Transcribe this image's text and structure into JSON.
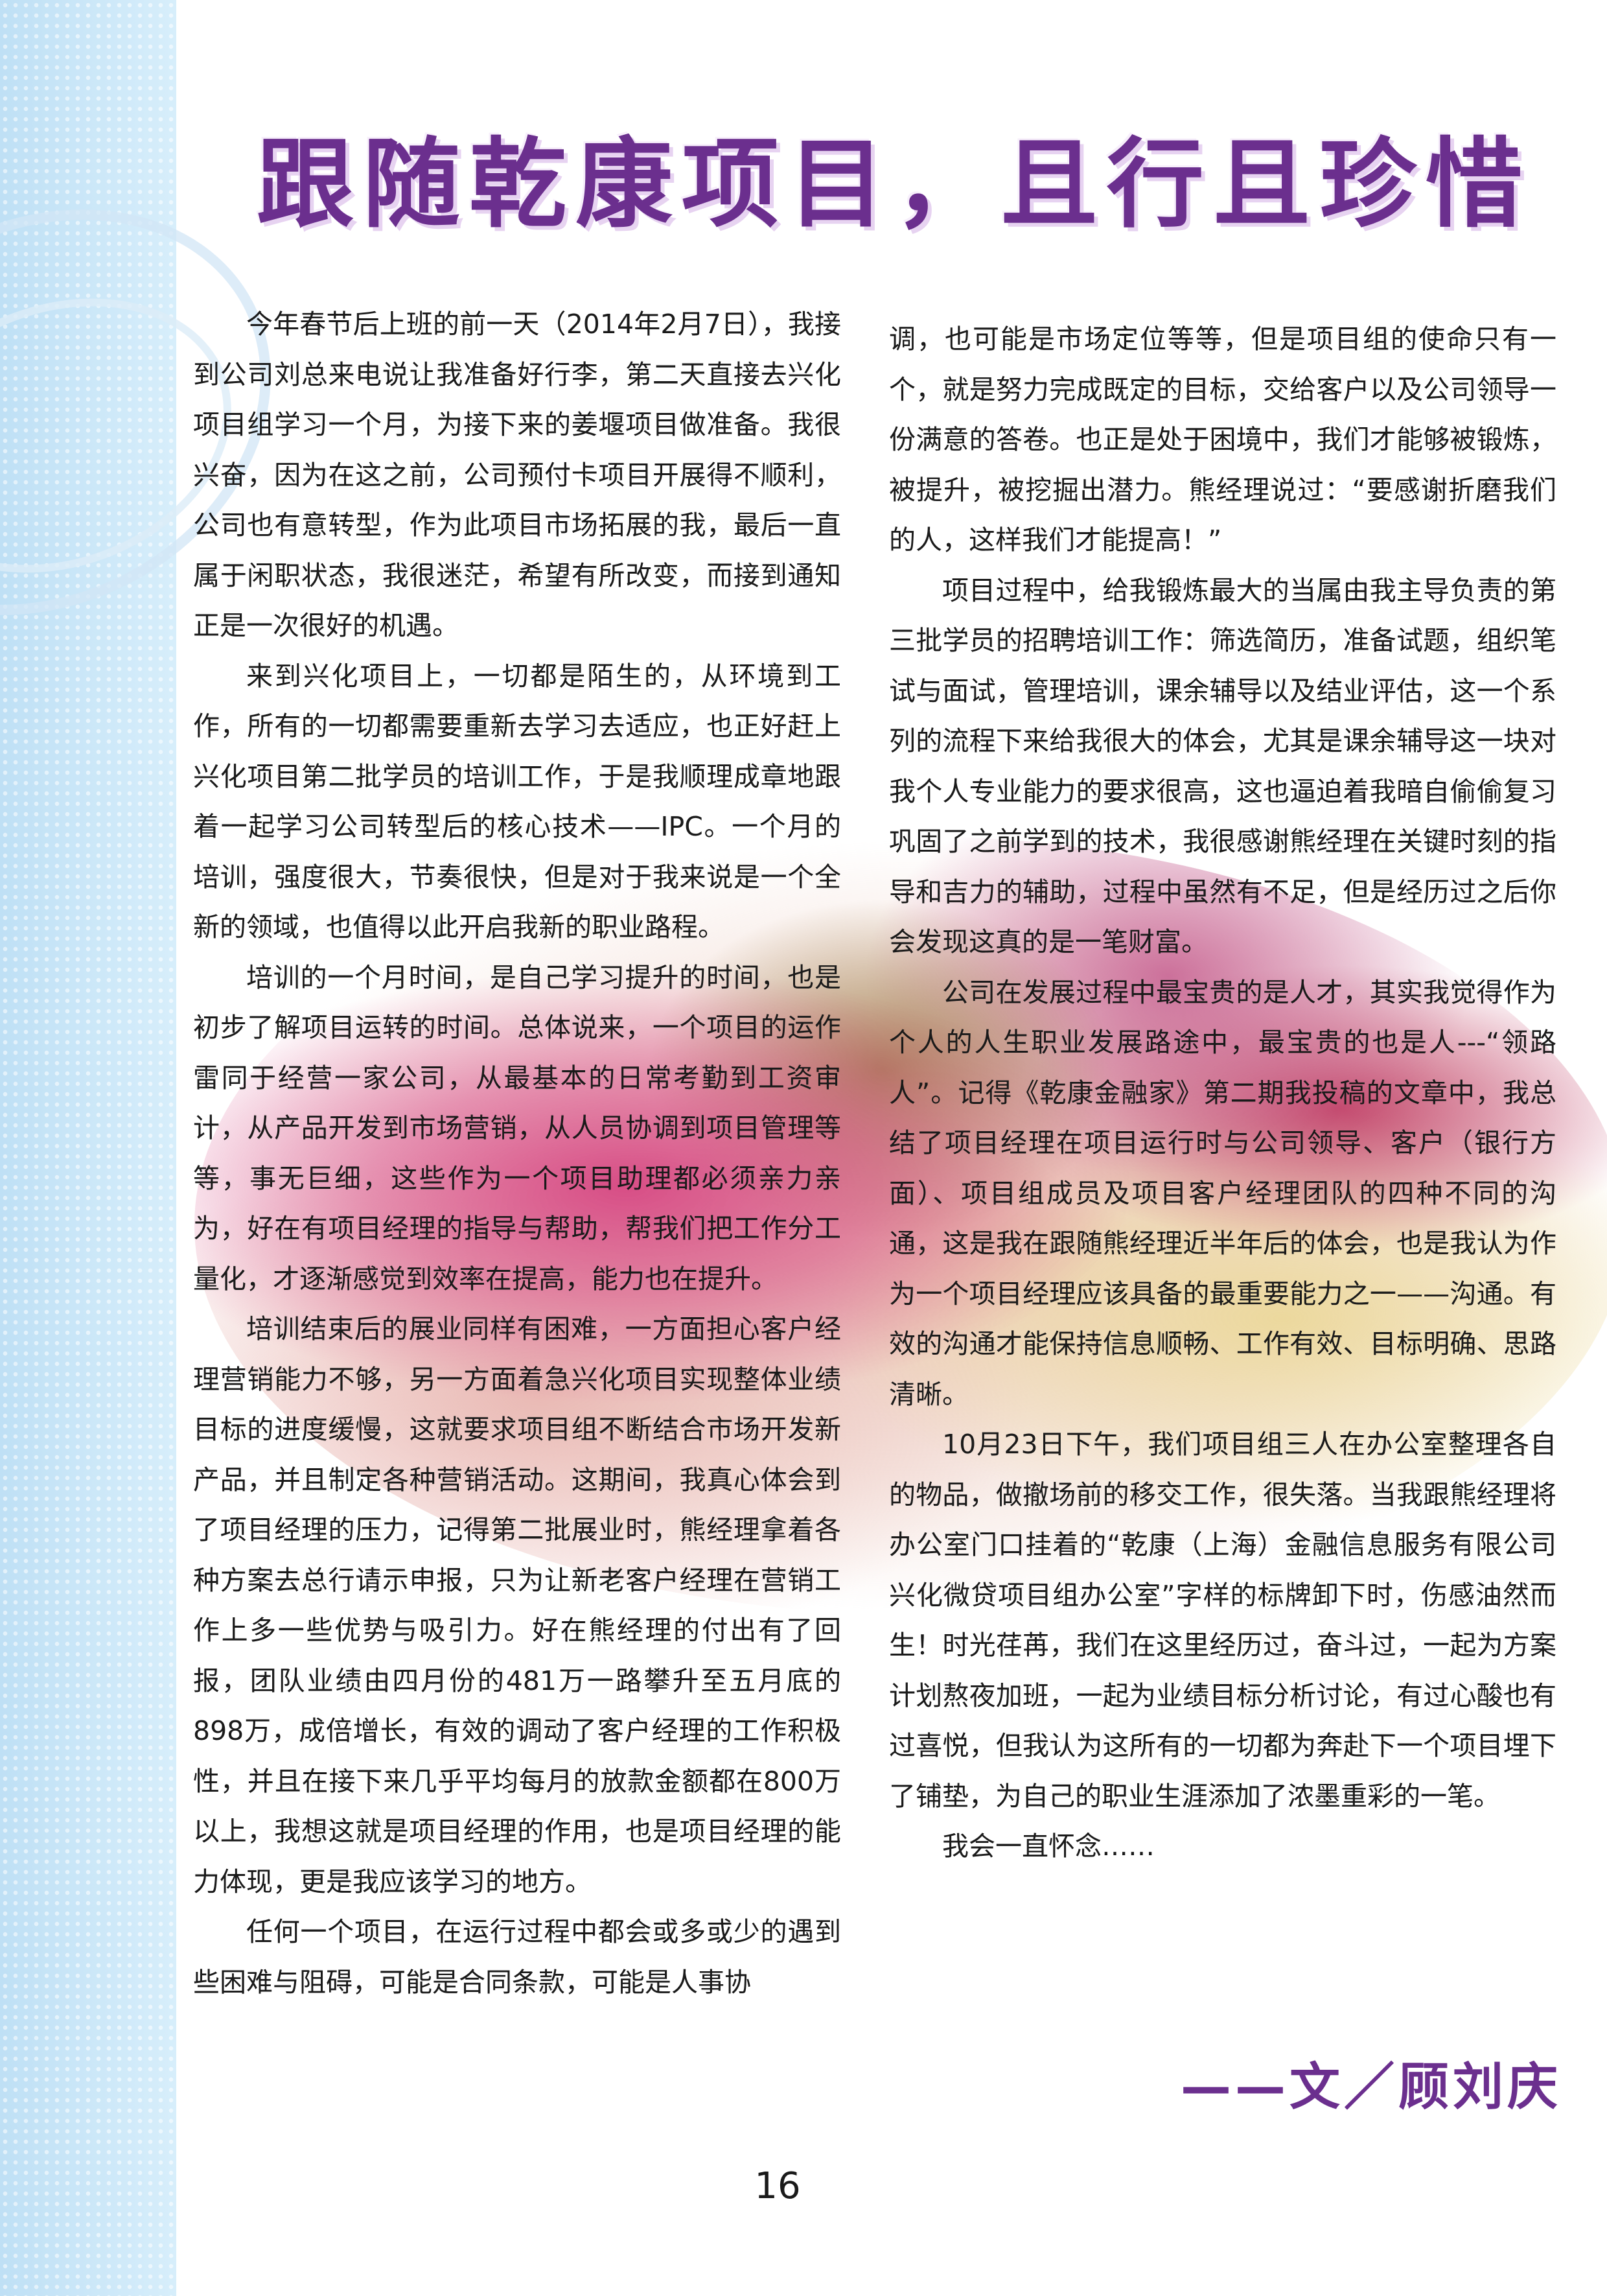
{
  "title": "跟随乾康项目，且行且珍惜",
  "left_column": [
    {
      "text": "今年春节后上班的前一天（2014年2月7日），我接到公司刘总来电说让我准备好行李，第二天直接去兴化项目组学习一个月，为接下来的姜堰项目做准备。我很兴奋，因为在这之前，公司预付卡项目开展得不顺利，公司也有意转型，作为此项目市场拓展的我，最后一直属于闲职状态，我很迷茫，希望有所改变，而接到通知正是一次很好的机遇。",
      "indent": true
    },
    {
      "text": "来到兴化项目上，一切都是陌生的，从环境到工作，所有的一切都需要重新去学习去适应，也正好赶上兴化项目第二批学员的培训工作，于是我顺理成章地跟着一起学习公司转型后的核心技术——IPC。一个月的培训，强度很大，节奏很快，但是对于我来说是一个全新的领域，也值得以此开启我新的职业路程。",
      "indent": true
    },
    {
      "text": "培训的一个月时间，是自己学习提升的时间，也是初步了解项目运转的时间。总体说来，一个项目的运作雷同于经营一家公司，从最基本的日常考勤到工资审计，从产品开发到市场营销，从人员协调到项目管理等等，事无巨细，这些作为一个项目助理都必须亲力亲为，好在有项目经理的指导与帮助，帮我们把工作分工量化，才逐渐感觉到效率在提高，能力也在提升。",
      "indent": true
    },
    {
      "text": "培训结束后的展业同样有困难，一方面担心客户经理营销能力不够，另一方面着急兴化项目实现整体业绩目标的进度缓慢，这就要求项目组不断结合市场开发新产品，并且制定各种营销活动。这期间，我真心体会到了项目经理的压力，记得第二批展业时，熊经理拿着各种方案去总行请示申报，只为让新老客户经理在营销工作上多一些优势与吸引力。好在熊经理的付出有了回报，团队业绩由四月份的481万一路攀升至五月底的898万，成倍增长，有效的调动了客户经理的工作积极性，并且在接下来几乎平均每月的放款金额都在800万以上，我想这就是项目经理的作用，也是项目经理的能力体现，更是我应该学习的地方。",
      "indent": true
    },
    {
      "text": "任何一个项目，在运行过程中都会或多或少的遇到些困难与阻碍，可能是合同条款，可能是人事协",
      "indent": true
    }
  ],
  "right_column": [
    {
      "text": "调，也可能是市场定位等等，但是项目组的使命只有一个，就是努力完成既定的目标，交给客户以及公司领导一份满意的答卷。也正是处于困境中，我们才能够被锻炼，被提升，被挖掘出潜力。熊经理说过：“要感谢折磨我们的人，这样我们才能提高！”",
      "indent": false
    },
    {
      "text": "项目过程中，给我锻炼最大的当属由我主导负责的第三批学员的招聘培训工作：筛选简历，准备试题，组织笔试与面试，管理培训，课余辅导以及结业评估，这一个系列的流程下来给我很大的体会，尤其是课余辅导这一块对我个人专业能力的要求很高，这也逼迫着我暗自偷偷复习巩固了之前学到的技术，我很感谢熊经理在关键时刻的指导和吉力的辅助，过程中虽然有不足，但是经历过之后你会发现这真的是一笔财富。",
      "indent": true
    },
    {
      "text": "公司在发展过程中最宝贵的是人才，其实我觉得作为个人的人生职业发展路途中，最宝贵的也是人---“领路人”。记得《乾康金融家》第二期我投稿的文章中，我总结了项目经理在项目运行时与公司领导、客户（银行方面）、项目组成员及项目客户经理团队的四种不同的沟通，这是我在跟随熊经理近半年后的体会，也是我认为作为一个项目经理应该具备的最重要能力之一——沟通。有效的沟通才能保持信息顺畅、工作有效、目标明确、思路清晰。",
      "indent": true
    },
    {
      "text": "10月23日下午，我们项目组三人在办公室整理各自的物品，做撤场前的移交工作，很失落。当我跟熊经理将办公室门口挂着的“乾康（上海）金融信息服务有限公司 兴化微贷项目组办公室”字样的标牌卸下时，伤感油然而生！时光荏苒，我们在这里经历过，奋斗过，一起为方案计划熬夜加班，一起为业绩目标分析讨论，有过心酸也有过喜悦，但我认为这所有的一切都为奔赴下一个项目埋下了铺垫，为自己的职业生涯添加了浓墨重彩的一笔。",
      "indent": true
    },
    {
      "text": "我会一直怀念……",
      "indent": true
    }
  ],
  "author": "——文／顾刘庆",
  "page_number": "16",
  "colors": {
    "title": "#6b2f8e",
    "sidebar": "#c9e6f7",
    "text": "#1a1a1a"
  }
}
